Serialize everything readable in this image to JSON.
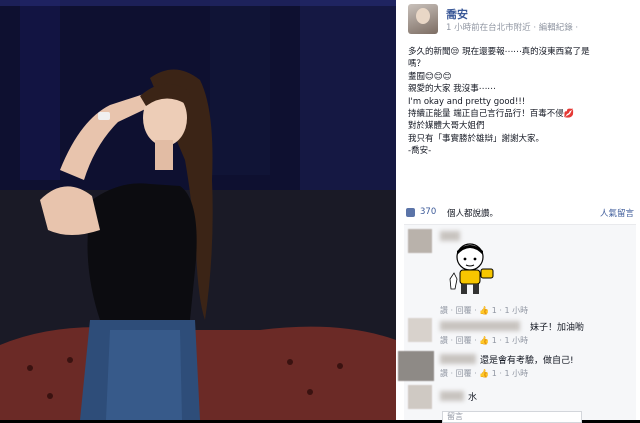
{
  "post": {
    "author": "喬安",
    "meta": "1 小時前在台北市附近 · 編輯紀錄 ·",
    "lines": [
      "多久的新聞😒 現在還要報⋯⋯真的沒東西寫了是",
      "嗎？",
      "耋囿😊😊😊",
      "親愛的大家 我沒事⋯⋯",
      "I'm okay and pretty good!!!",
      "持續正能量 端正自己言行品行！百毒不侵💋",
      "對於媒體大哥大姐們",
      "我只有「事實勝於雄辯」謝謝大家。",
      "-喬安-"
    ]
  },
  "likes": {
    "count": "370",
    "rest": "個人都說讚。",
    "all_comments": "人氣留言"
  },
  "comments": [
    {
      "text": "",
      "actions": "讚 · 回覆 · 👍 1 · 1 小時",
      "has_sticker": true
    },
    {
      "text": "妹子！加油喲",
      "actions": "讚 · 回覆 · 👍 1 · 1 小時"
    },
    {
      "text": "還是會有考驗，做自己!",
      "actions": "讚 · 回覆 · 👍 1 · 1 小時"
    },
    {
      "text": "水",
      "actions": ""
    }
  ],
  "reply_placeholder": "留言",
  "icons": [
    "thumbs-up-icon",
    "avatar-icon",
    "sticker-icon"
  ],
  "colors": {
    "link": "#3b5998",
    "muted": "#9197a3",
    "comment_bg": "#f6f7f9"
  }
}
